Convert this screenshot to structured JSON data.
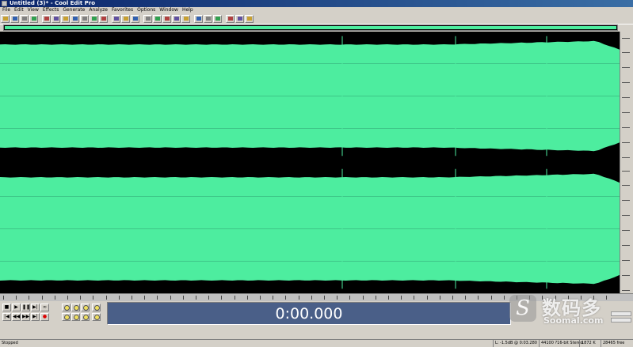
{
  "window": {
    "title": "Untitled (3)* - Cool Edit Pro"
  },
  "menu": [
    "File",
    "Edit",
    "View",
    "Effects",
    "Generate",
    "Analyze",
    "Favorites",
    "Options",
    "Window",
    "Help"
  ],
  "toolbar": {
    "button_icons": [
      "new-file-icon",
      "open-file-icon",
      "save-icon",
      "save-all-icon",
      "cut-icon",
      "copy-icon",
      "paste-icon",
      "mix-paste-icon",
      "undo-icon",
      "redo-icon",
      "repeat-icon",
      "waveform-view-icon",
      "spectral-view-icon",
      "multitrack-icon",
      "loop-icon",
      "metronome-icon",
      "cd-icon",
      "settings-icon",
      "help-icon",
      "tool-1-icon",
      "tool-2-icon",
      "tool-3-icon",
      "tool-4-icon",
      "tool-5-icon",
      "tool-6-icon"
    ]
  },
  "waveform": {
    "color": "#4ded9f",
    "background": "#000000",
    "channels": 2
  },
  "transport": {
    "time": "0:00.000",
    "buttons": [
      "stop",
      "play",
      "pause",
      "play-to-end",
      "loop-play",
      "go-to-start",
      "rewind",
      "fast-forward",
      "go-to-end",
      "record"
    ]
  },
  "statusbar": {
    "state": "Stopped",
    "level": "L: -1.5dB @ 0:03.280",
    "format": "44100 ?16-bit Stereo",
    "size": "1872 K",
    "free": "28465 free"
  },
  "watermark": {
    "cn": "数码多",
    "en": "Soomal.com"
  }
}
